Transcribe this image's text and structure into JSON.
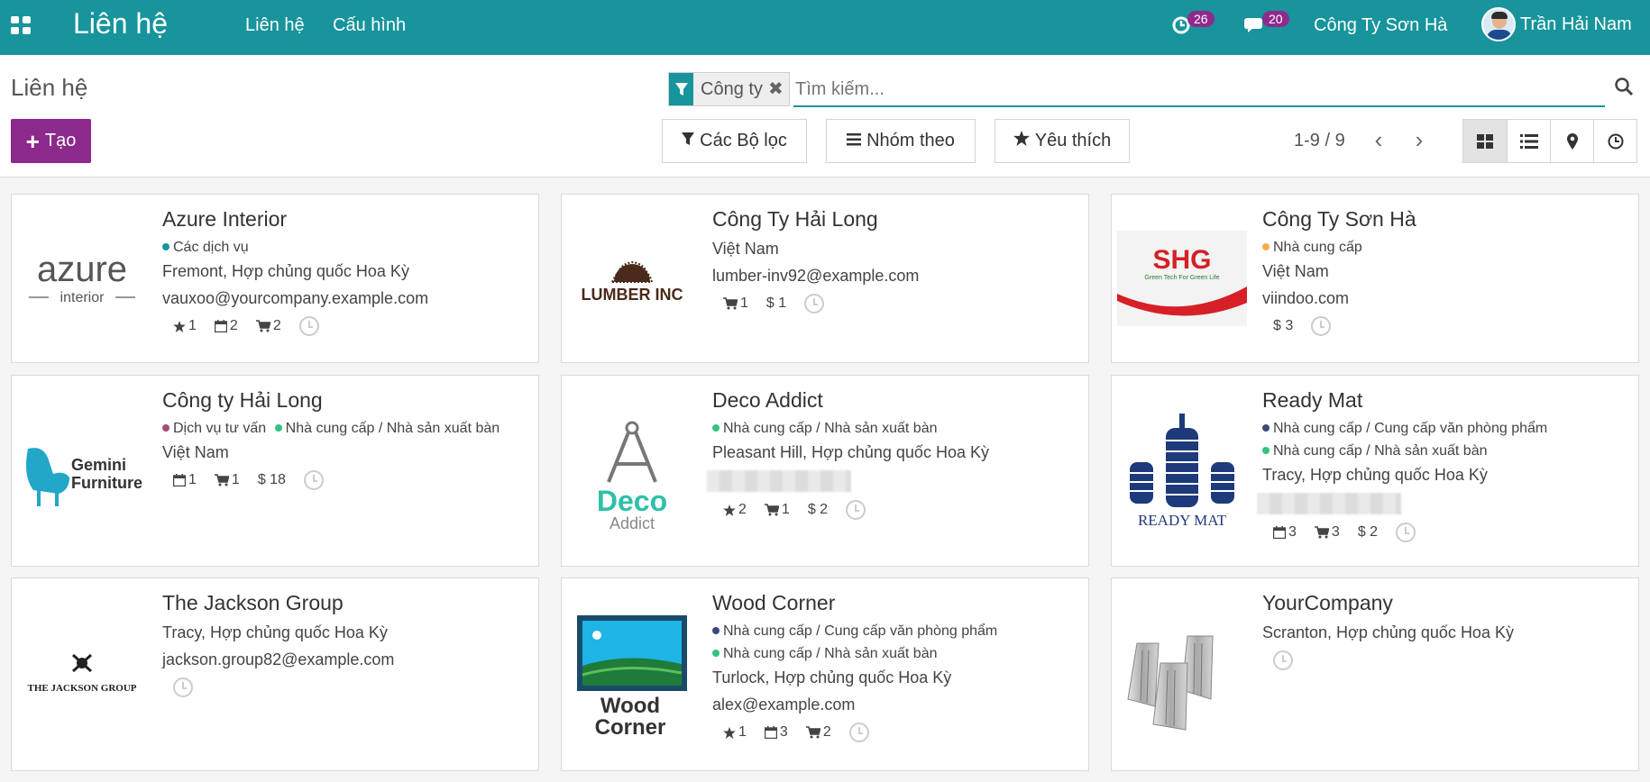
{
  "navbar": {
    "brand": "Liên hệ",
    "menu": [
      "Liên hệ",
      "Cấu hình"
    ],
    "activity_count": "26",
    "messages_count": "20",
    "company": "Công Ty Sơn Hà",
    "user": "Trần Hải Nam"
  },
  "control_panel": {
    "breadcrumb": "Liên hệ",
    "create_label": "Tạo",
    "facet_label": "Công ty",
    "search_placeholder": "Tìm kiếm...",
    "filters_label": "Các Bộ lọc",
    "group_by_label": "Nhóm theo",
    "favorites_label": "Yêu thích",
    "pager": "1-9 / 9"
  },
  "colors": {
    "navbar": "#17949c",
    "create_button": "#8b2a8b",
    "badge": "#8f2a8c"
  },
  "cards": [
    {
      "name": "Azure Interior",
      "tags": [
        {
          "label": "Các dịch vụ",
          "color": "#17949c"
        }
      ],
      "lines": [
        "Fremont, Hợp chủng quốc Hoa Kỳ",
        "vauxoo@yourcompany.example.com"
      ],
      "stats": {
        "star": "1",
        "calendar": "2",
        "cart": "2"
      },
      "logo": {
        "text": "azure",
        "subtext": "interior"
      }
    },
    {
      "name": "Công Ty Hải Long",
      "tags": [],
      "lines": [
        "Việt Nam",
        "lumber-inv92@example.com"
      ],
      "stats": {
        "cart": "1",
        "dollar": "1"
      },
      "logo": {
        "text": "LUMBER INC"
      }
    },
    {
      "name": "Công Ty Sơn Hà",
      "tags": [
        {
          "label": "Nhà cung cấp",
          "color": "#f0ad4e"
        }
      ],
      "lines": [
        "Việt Nam",
        "viindoo.com"
      ],
      "stats": {
        "dollar": "3"
      },
      "logo": {
        "text": "SHG",
        "subtext": "Green Tech For Green Life"
      }
    },
    {
      "name": "Công ty Hải Long",
      "tags": [
        {
          "label": "Dịch vụ tư vấn",
          "color": "#a64d79"
        },
        {
          "label": "Nhà cung cấp / Nhà sản xuất bàn",
          "color": "#30c381"
        }
      ],
      "lines": [
        "Việt Nam"
      ],
      "stats": {
        "calendar": "1",
        "cart": "1",
        "dollar": "18"
      },
      "logo": {
        "text": "Gemini",
        "subtext": "Furniture"
      }
    },
    {
      "name": "Deco Addict",
      "tags": [
        {
          "label": "Nhà cung cấp / Nhà sản xuất bàn",
          "color": "#30c381"
        }
      ],
      "lines": [
        "Pleasant Hill, Hợp chủng quốc Hoa Kỳ"
      ],
      "stats": {
        "star": "2",
        "cart": "1",
        "dollar": "2"
      },
      "logo": {
        "text": "Deco",
        "subtext": "Addict"
      }
    },
    {
      "name": "Ready Mat",
      "tags": [
        {
          "label": "Nhà cung cấp / Cung cấp văn phòng phẩm",
          "color": "#3c4a7a"
        },
        {
          "label": "Nhà cung cấp / Nhà sản xuất bàn",
          "color": "#30c381"
        }
      ],
      "lines": [
        "Tracy, Hợp chủng quốc Hoa Kỳ"
      ],
      "stats": {
        "calendar": "3",
        "cart": "3",
        "dollar": "2"
      },
      "logo": {
        "text": "READY MAT"
      }
    },
    {
      "name": "The Jackson Group",
      "tags": [],
      "lines": [
        "Tracy, Hợp chủng quốc Hoa Kỳ",
        "jackson.group82@example.com"
      ],
      "stats": {},
      "logo": {
        "text": "THE JACKSON GROUP"
      }
    },
    {
      "name": "Wood Corner",
      "tags": [
        {
          "label": "Nhà cung cấp / Cung cấp văn phòng phẩm",
          "color": "#3c4a7a"
        },
        {
          "label": "Nhà cung cấp / Nhà sản xuất bàn",
          "color": "#30c381"
        }
      ],
      "lines": [
        "Turlock, Hợp chủng quốc Hoa Kỳ",
        "alex@example.com"
      ],
      "stats": {
        "star": "1",
        "calendar": "3",
        "cart": "2"
      },
      "logo": {
        "text": "Wood",
        "subtext": "Corner"
      }
    },
    {
      "name": "YourCompany",
      "tags": [],
      "lines": [
        "Scranton, Hợp chủng quốc Hoa Kỳ"
      ],
      "stats": {},
      "logo": {
        "text": ""
      }
    }
  ]
}
